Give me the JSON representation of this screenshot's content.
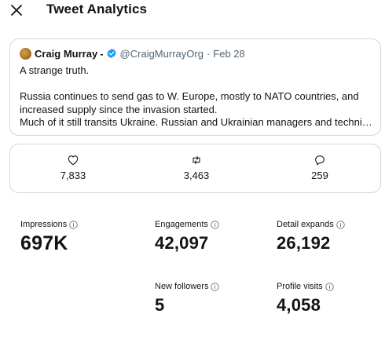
{
  "header": {
    "title": "Tweet Analytics",
    "close_icon": "close-icon"
  },
  "tweet": {
    "author": "Craig Murray",
    "author_suffix": "-",
    "handle": "@CraigMurrayOrg",
    "separator": "·",
    "date": "Feb 28",
    "verified_color": "#1d9bf0",
    "lines": [
      "A strange truth.",
      "Russia continues to send gas to W. Europe, mostly to NATO countries, and",
      "increased supply since the invasion started.",
      "Much of it still transits Ukraine. Russian and Ukrainian managers and technicia…"
    ]
  },
  "engagement": {
    "likes": "7,833",
    "retweets": "3,463",
    "replies": "259"
  },
  "metrics": {
    "impressions": {
      "label": "Impressions",
      "value": "697K"
    },
    "engagements": {
      "label": "Engagements",
      "value": "42,097"
    },
    "detail_expands": {
      "label": "Detail expands",
      "value": "26,192"
    },
    "new_followers": {
      "label": "New followers",
      "value": "5"
    },
    "profile_visits": {
      "label": "Profile visits",
      "value": "4,058"
    }
  },
  "colors": {
    "text": "#0f1419",
    "secondary": "#536471",
    "border": "#cfd9de",
    "accent": "#1d9bf0"
  }
}
